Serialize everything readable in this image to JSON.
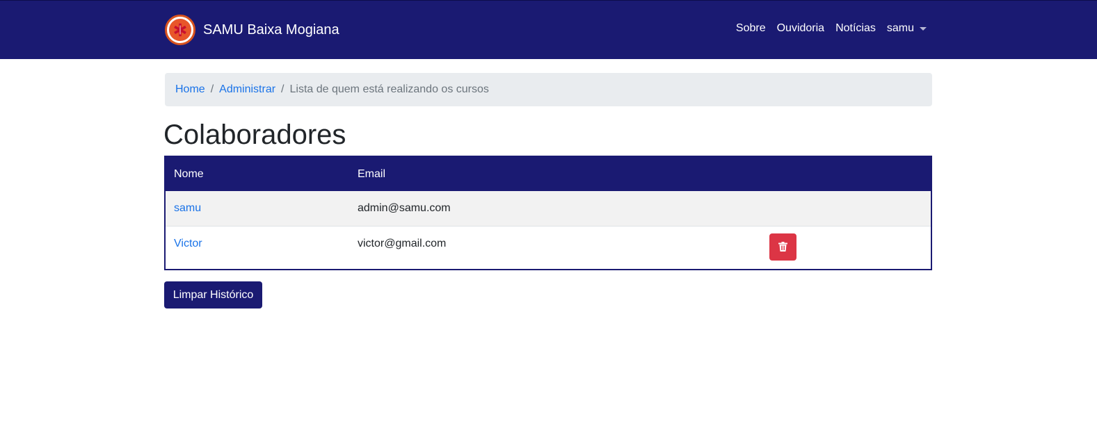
{
  "navbar": {
    "brand": "SAMU Baixa Mogiana",
    "logo_icon": "star-of-life-icon",
    "links": [
      "Sobre",
      "Ouvidoria",
      "Notícias"
    ],
    "user": "samu",
    "background_color": "#1a1a72"
  },
  "breadcrumb": {
    "items": [
      "Home",
      "Administrar"
    ],
    "active": "Lista de quem está realizando os cursos",
    "separator": "/"
  },
  "page": {
    "title": "Colaboradores"
  },
  "table": {
    "headers": [
      "Nome",
      "Email",
      ""
    ],
    "rows": [
      {
        "name": "samu",
        "email": "admin@samu.com",
        "has_delete": false
      },
      {
        "name": "Victor",
        "email": "victor@gmail.com",
        "has_delete": true
      }
    ],
    "delete_icon": "trash-icon",
    "delete_color": "#dc3545"
  },
  "actions": {
    "clear_history": "Limpar Histórico"
  }
}
